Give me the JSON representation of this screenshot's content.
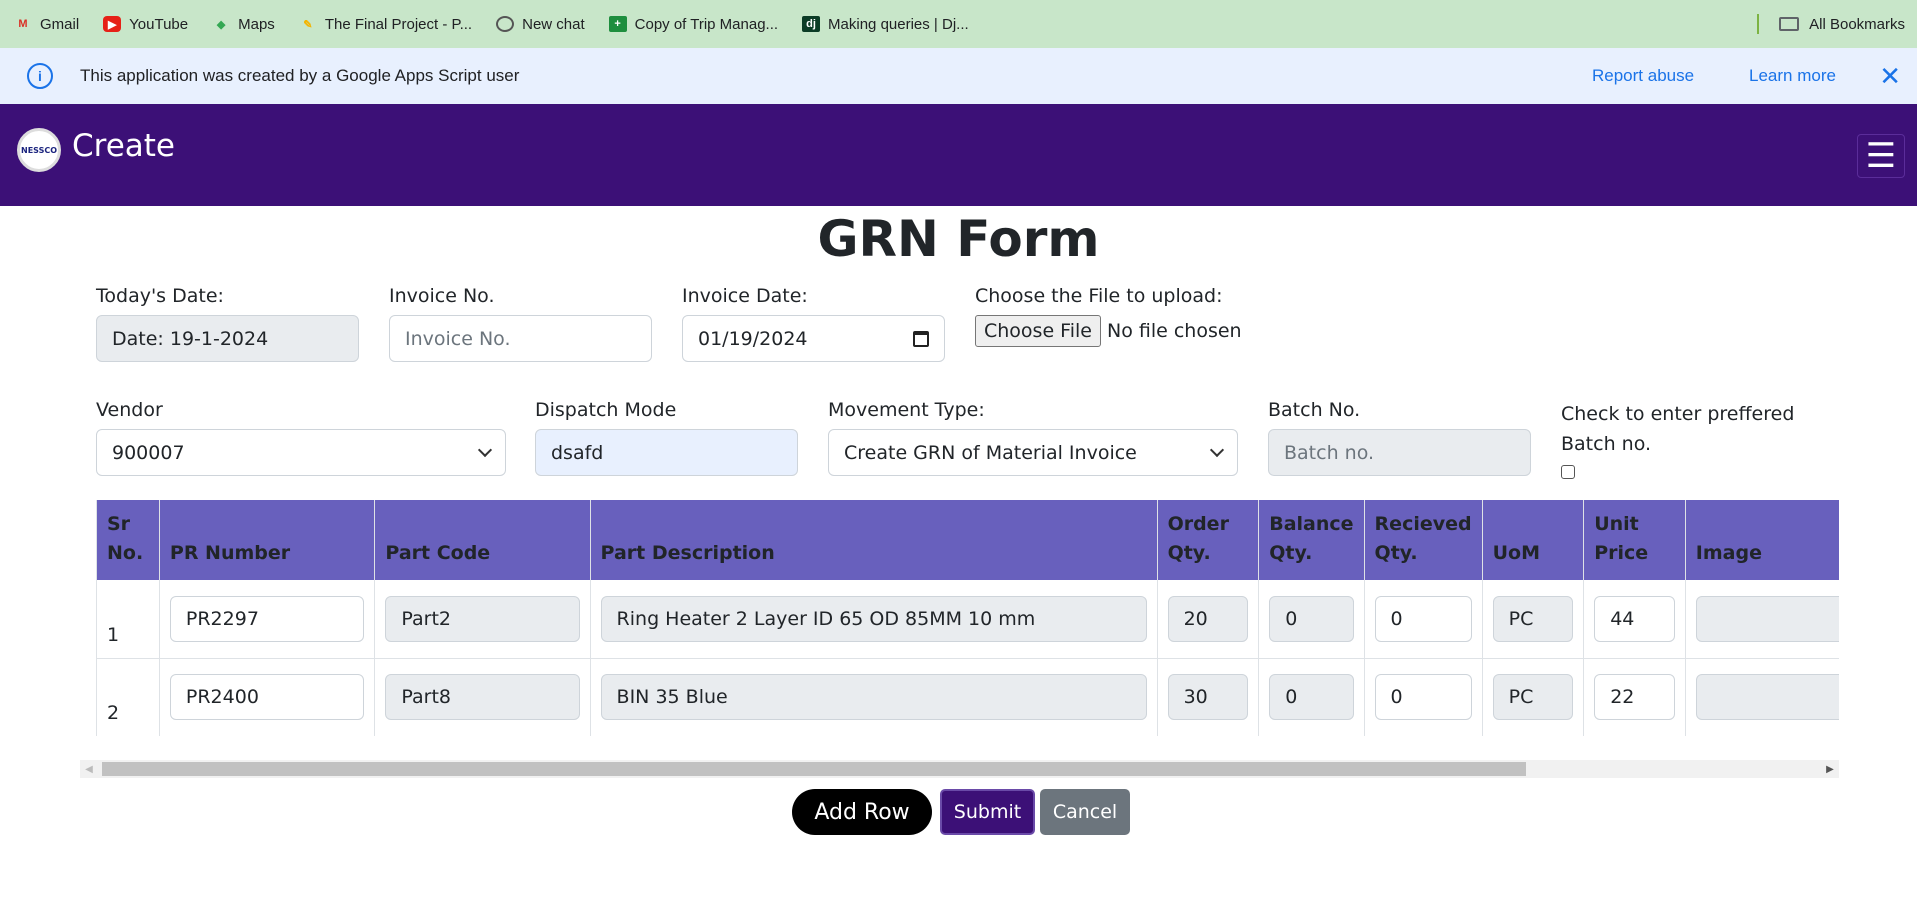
{
  "bookmarks": [
    {
      "label": "Gmail",
      "icon": "gmail-icon",
      "glyph": "M"
    },
    {
      "label": "YouTube",
      "icon": "youtube-icon",
      "glyph": "▶"
    },
    {
      "label": "Maps",
      "icon": "maps-icon",
      "glyph": "◆"
    },
    {
      "label": "The Final Project - P...",
      "icon": "project-icon",
      "glyph": "✎"
    },
    {
      "label": "New chat",
      "icon": "chatgpt-icon",
      "glyph": ""
    },
    {
      "label": "Copy of Trip Manag...",
      "icon": "sheets-icon",
      "glyph": "+"
    },
    {
      "label": "Making queries | Dj...",
      "icon": "django-icon",
      "glyph": "dj"
    }
  ],
  "all_bookmarks": "All Bookmarks",
  "banner": {
    "message": "This application was created by a Google Apps Script user",
    "report": "Report abuse",
    "learn": "Learn more"
  },
  "navbar": {
    "brand": "Create",
    "logo_text": "NESSCO"
  },
  "form": {
    "title": "GRN Form",
    "todays_date_label": "Today's Date:",
    "todays_date_value": "Date: 19-1-2024",
    "invoice_no_label": "Invoice No.",
    "invoice_no_placeholder": "Invoice No.",
    "invoice_date_label": "Invoice Date:",
    "invoice_date_value": "01/19/2024",
    "file_label": "Choose the File to upload:",
    "file_button": "Choose File",
    "file_status": "No file chosen",
    "vendor_label": "Vendor",
    "vendor_value": "900007",
    "dispatch_label": "Dispatch Mode",
    "dispatch_value": "dsafd",
    "movement_label": "Movement Type:",
    "movement_value": "Create GRN of Material Invoice",
    "batch_label": "Batch No.",
    "batch_placeholder": "Batch no.",
    "pref_batch_label": "Check to enter preffered Batch no."
  },
  "table": {
    "headers": [
      "Sr No.",
      "PR Number",
      "Part Code",
      "Part Description",
      "Order Qty.",
      "Balance Qty.",
      "Recieved Qty.",
      "UoM",
      "Unit Price",
      "Image"
    ],
    "rows": [
      {
        "sr": "1",
        "pr": "PR2297",
        "part_code": "Part2",
        "desc": "Ring Heater 2 Layer ID 65 OD 85MM 10 mm",
        "order": "20",
        "balance": "0",
        "received": "0",
        "uom": "PC",
        "price": "44",
        "image": ""
      },
      {
        "sr": "2",
        "pr": "PR2400",
        "part_code": "Part8",
        "desc": "BIN 35 Blue",
        "order": "30",
        "balance": "0",
        "received": "0",
        "uom": "PC",
        "price": "22",
        "image": ""
      }
    ]
  },
  "buttons": {
    "add_row": "Add Row",
    "submit": "Submit",
    "cancel": "Cancel"
  }
}
